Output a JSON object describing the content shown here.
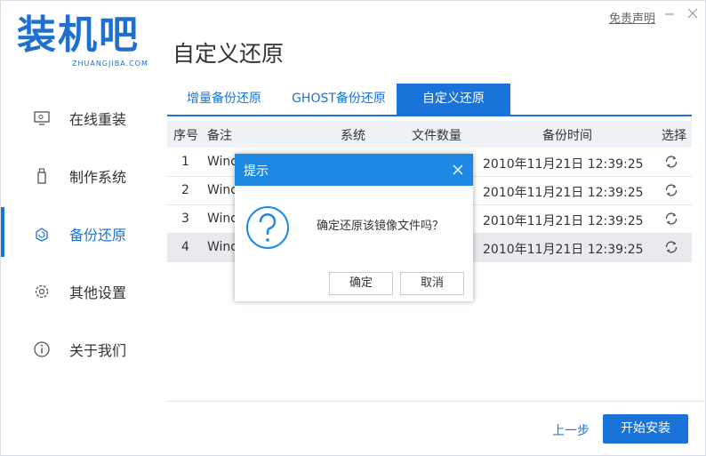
{
  "window": {
    "logo_text": "装机吧",
    "logo_sub": "ZHUANGJIBA.COM",
    "page_title": "自定义还原",
    "disclaimer": "免责声明"
  },
  "sidebar": {
    "items": [
      {
        "label": "在线重装",
        "icon": "monitor-icon"
      },
      {
        "label": "制作系统",
        "icon": "usb-drive-icon"
      },
      {
        "label": "备份还原",
        "icon": "backup-restore-icon",
        "active": true
      },
      {
        "label": "其他设置",
        "icon": "gear-icon"
      },
      {
        "label": "关于我们",
        "icon": "info-icon"
      }
    ]
  },
  "tabs": [
    {
      "label": "增量备份还原"
    },
    {
      "label": "GHOST备份还原"
    },
    {
      "label": "自定义还原",
      "active": true
    }
  ],
  "table": {
    "headers": {
      "index": "序号",
      "note": "备注",
      "system": "系统",
      "file_count": "文件数量",
      "backup_time": "备份时间",
      "select": "选择"
    },
    "rows": [
      {
        "index": "1",
        "note": "Wind",
        "time": "2010年11月21日 12:39:25"
      },
      {
        "index": "2",
        "note": "Wind",
        "time": "2010年11月21日 12:39:25"
      },
      {
        "index": "3",
        "note": "Wind",
        "time": "2010年11月21日 12:39:25"
      },
      {
        "index": "4",
        "note": "Wind",
        "time": "2010年11月21日 12:39:25"
      }
    ]
  },
  "footer": {
    "prev_label": "上一步",
    "install_label": "开始安装"
  },
  "dialog": {
    "title": "提示",
    "message": "确定还原该镜像文件吗？",
    "ok_label": "确定",
    "cancel_label": "取消"
  },
  "colors": {
    "accent": "#1a73d9",
    "dialog_header": "#1e88e5"
  }
}
